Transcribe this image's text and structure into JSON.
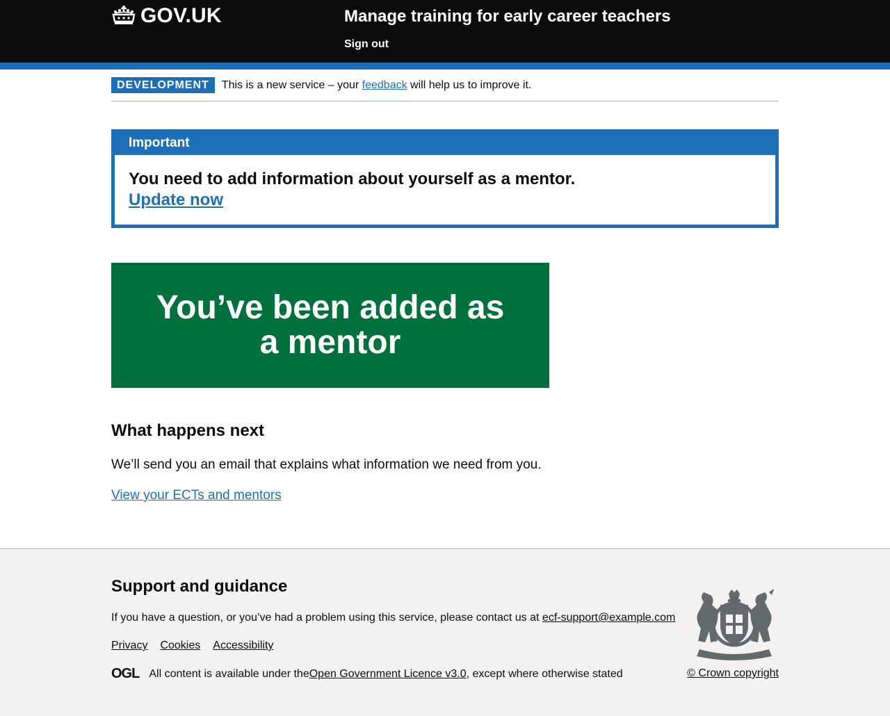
{
  "header": {
    "logo_text": "GOV.UK",
    "service_name": "Manage training for early career teachers",
    "sign_out": "Sign out"
  },
  "phase_banner": {
    "tag": "DEVELOPMENT",
    "text_before": "This is a new service – your ",
    "link": "feedback",
    "text_after": " will help us to improve it."
  },
  "notification": {
    "title": "Important",
    "heading": "You need to add information about yourself as a mentor.",
    "link": "Update now"
  },
  "panel": {
    "title": "You’ve been added as a mentor"
  },
  "next_steps": {
    "heading": "What happens next",
    "body": "We’ll send you an email that explains what information we need from you.",
    "link": "View your ECTs and mentors"
  },
  "footer": {
    "heading": "Support and guidance",
    "support_text": "If you have a question, or you’ve had a problem using this service, please contact us at ",
    "support_email": "ecf-support@example.com",
    "links": [
      "Privacy",
      "Cookies",
      "Accessibility"
    ],
    "ogl_logo": "OGL",
    "licence_before": "All content is available under the ",
    "licence_link": "Open Government Licence v3.0",
    "licence_after": ", except where otherwise stated",
    "copyright": "© Crown copyright"
  },
  "colors": {
    "header_bg": "#0b0c0c",
    "brand_blue": "#1d70b8",
    "success_green": "#00703c",
    "footer_bg": "#f3f2f1"
  }
}
